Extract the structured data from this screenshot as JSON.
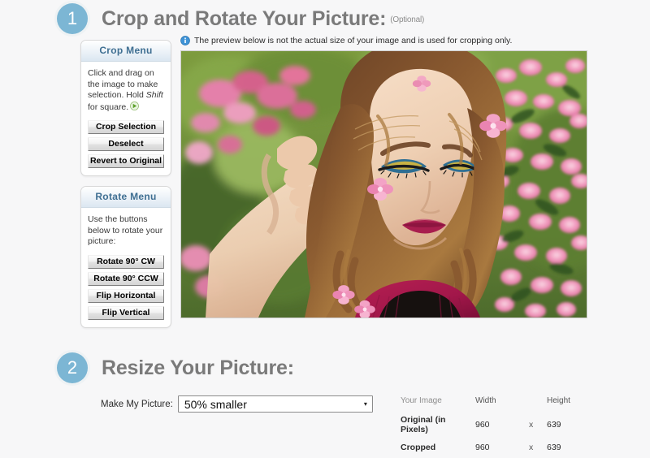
{
  "steps": [
    {
      "number": "1",
      "title": "Crop and Rotate Your Picture:",
      "optional": "(Optional)"
    },
    {
      "number": "2",
      "title": "Resize Your Picture:",
      "optional": ""
    }
  ],
  "notice": {
    "icon": "info-icon",
    "text": "The preview below is not the actual size of your image and is used for cropping only."
  },
  "crop_menu": {
    "heading": "Crop Menu",
    "note_line1": "Click and drag on the",
    "note_line2": "image to make selection.",
    "note_line3_pre": "Hold ",
    "note_line3_em": "Shift",
    "note_line3_post": " for square.",
    "arrow_icon": "green-arrow-icon",
    "buttons": [
      {
        "label": "Crop Selection",
        "name": "crop-selection-button"
      },
      {
        "label": "Deselect",
        "name": "deselect-button"
      },
      {
        "label": "Revert to Original",
        "name": "revert-to-original-button"
      }
    ]
  },
  "rotate_menu": {
    "heading": "Rotate Menu",
    "note_line1": "Use the buttons below",
    "note_line2": "to rotate your picture:",
    "buttons": [
      {
        "label": "Rotate 90° CW",
        "name": "rotate-90-cw-button"
      },
      {
        "label": "Rotate 90° CCW",
        "name": "rotate-90-ccw-button"
      },
      {
        "label": "Flip Horizontal",
        "name": "flip-horizontal-button"
      },
      {
        "label": "Flip Vertical",
        "name": "flip-vertical-button"
      }
    ]
  },
  "preview": {
    "alt": "Woman with pink flowers in hair, pink dress, blossoming shrub background"
  },
  "resize": {
    "label": "Make My Picture:",
    "selected_option": "50% smaller",
    "caret": "▾"
  },
  "image_info": {
    "headers": {
      "image": "Your Image",
      "width": "Width",
      "x": "",
      "height": "Height"
    },
    "rows": [
      {
        "label": "Original (in Pixels)",
        "width": "960",
        "sep": "x",
        "height": "639"
      },
      {
        "label": "Cropped",
        "width": "960",
        "sep": "x",
        "height": "639"
      }
    ]
  },
  "colors": {
    "step_circle": "#7cb6d4",
    "title_gray": "#7a7a7a",
    "panel_head_text": "#3f6f92",
    "page_background": "#f7f7f8"
  }
}
